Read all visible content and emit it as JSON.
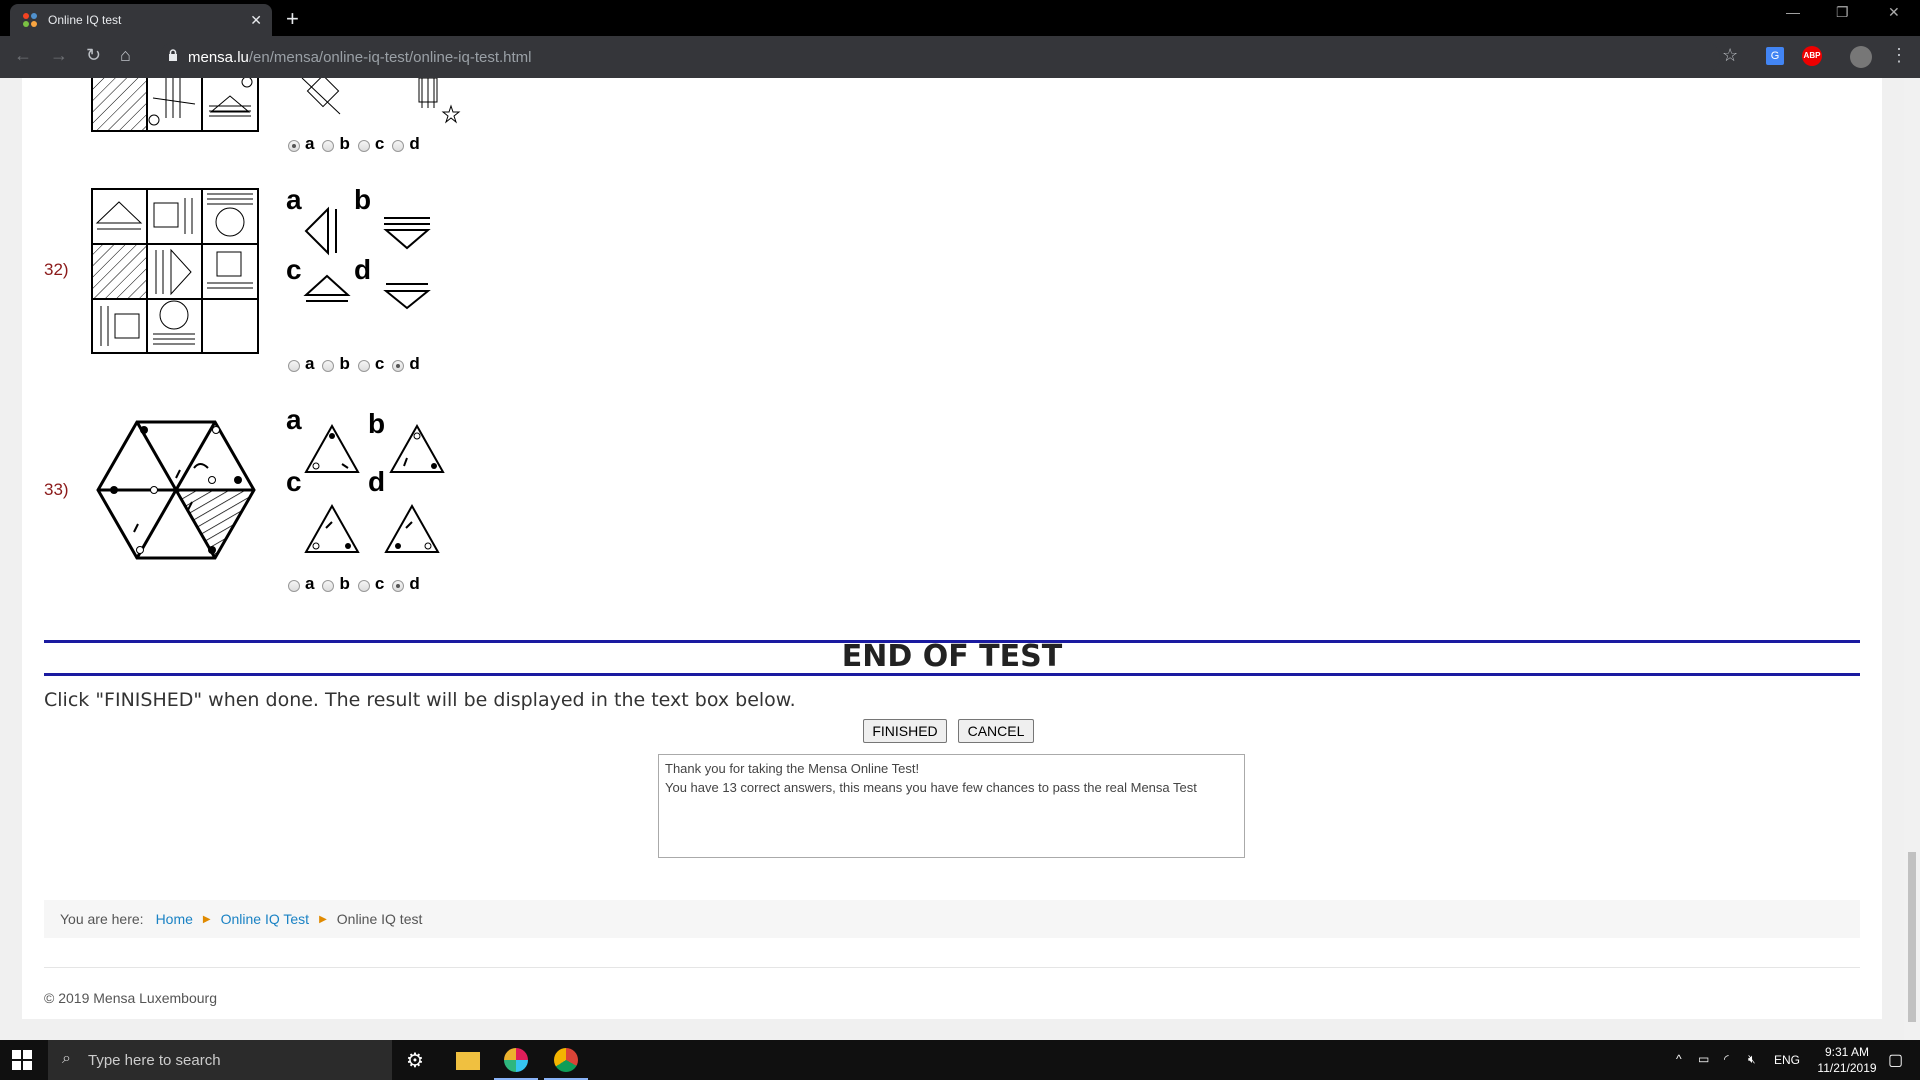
{
  "browser": {
    "tab_title": "Online IQ test",
    "url_host": "mensa.lu",
    "url_path": "/en/mensa/online-iq-test/online-iq-test.html",
    "extension_label": "ABP"
  },
  "questions": [
    {
      "number": "",
      "options": [
        "a",
        "b",
        "c",
        "d"
      ],
      "selected": "a"
    },
    {
      "number": "32)",
      "option_labels": [
        "a",
        "b",
        "c",
        "d"
      ],
      "options": [
        "a",
        "b",
        "c",
        "d"
      ],
      "selected": "d"
    },
    {
      "number": "33)",
      "option_labels": [
        "a",
        "b",
        "c",
        "d"
      ],
      "options": [
        "a",
        "b",
        "c",
        "d"
      ],
      "selected": "d"
    }
  ],
  "end": {
    "title": "END OF TEST",
    "instructions": "Click \"FINISHED\" when done. The result will be displayed in the text box below.",
    "finished_label": "FINISHED",
    "cancel_label": "CANCEL",
    "result_text": "Thank you for taking the Mensa Online Test!\nYou have 13 correct answers, this means you have few chances to pass the real Mensa Test"
  },
  "breadcrumb": {
    "prefix": "You are here:",
    "items": [
      "Home",
      "Online IQ Test",
      "Online IQ test"
    ]
  },
  "footer": {
    "copyright": "© 2019 Mensa Luxembourg"
  },
  "taskbar": {
    "search_placeholder": "Type here to search",
    "language": "ENG",
    "time": "9:31 AM",
    "date": "11/21/2019"
  },
  "colors": {
    "question_number": "#8b1a1a",
    "end_rule": "#1a1aa0",
    "link": "#1a82c4"
  }
}
